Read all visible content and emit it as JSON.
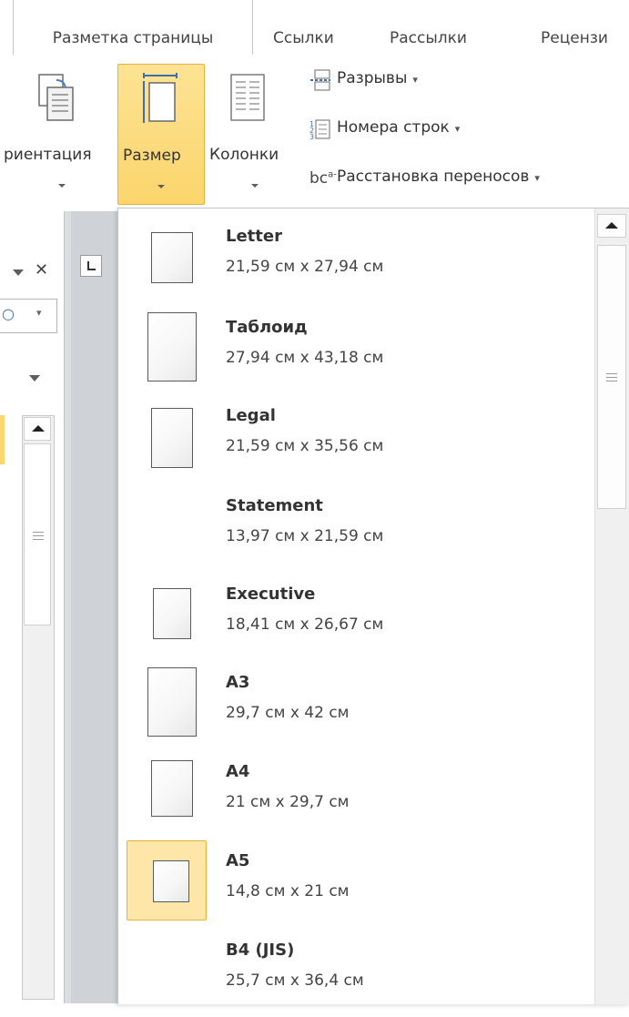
{
  "tabs": [
    {
      "label": "Разметка страницы",
      "active": true
    },
    {
      "label": "Ссылки",
      "active": false
    },
    {
      "label": "Рассылки",
      "active": false
    },
    {
      "label": "Рецензи",
      "active": false
    }
  ],
  "ribbon": {
    "orientation_label": "риентация",
    "size_label": "Размер",
    "columns_label": "Колонки",
    "breaks_label": "Разрывы",
    "line_numbers_label": "Номера строк",
    "hyphenation_label": "Расстановка переносов",
    "hyphenation_icon_text": "bc",
    "hyphenation_icon_sup": "a-"
  },
  "gallery": {
    "items": [
      {
        "name": "Letter",
        "dims": "21,59 см x 27,94 см",
        "icon": "page-icon"
      },
      {
        "name": "Таблоид",
        "dims": "27,94 см x 43,18 см",
        "icon": "page-icon"
      },
      {
        "name": "Legal",
        "dims": "21,59 см x 35,56 см",
        "icon": "page-icon"
      },
      {
        "name": "Statement",
        "dims": "13,97 см x 21,59 см",
        "icon": "none"
      },
      {
        "name": "Executive",
        "dims": "18,41 см x 26,67 см",
        "icon": "page-icon"
      },
      {
        "name": "A3",
        "dims": "29,7 см x 42 см",
        "icon": "page-icon"
      },
      {
        "name": "A4",
        "dims": "21 см x 29,7 см",
        "icon": "page-icon"
      },
      {
        "name": "A5",
        "dims": "14,8 см x 21 см",
        "icon": "page-icon",
        "selected": true
      },
      {
        "name": "B4 (JIS)",
        "dims": "25,7 см x 36,4 см",
        "icon": "none"
      }
    ]
  },
  "colors": {
    "accent_highlight": "#fcd56c",
    "accent_border": "#e8b23a",
    "selected_bg": "#fde6a7"
  }
}
